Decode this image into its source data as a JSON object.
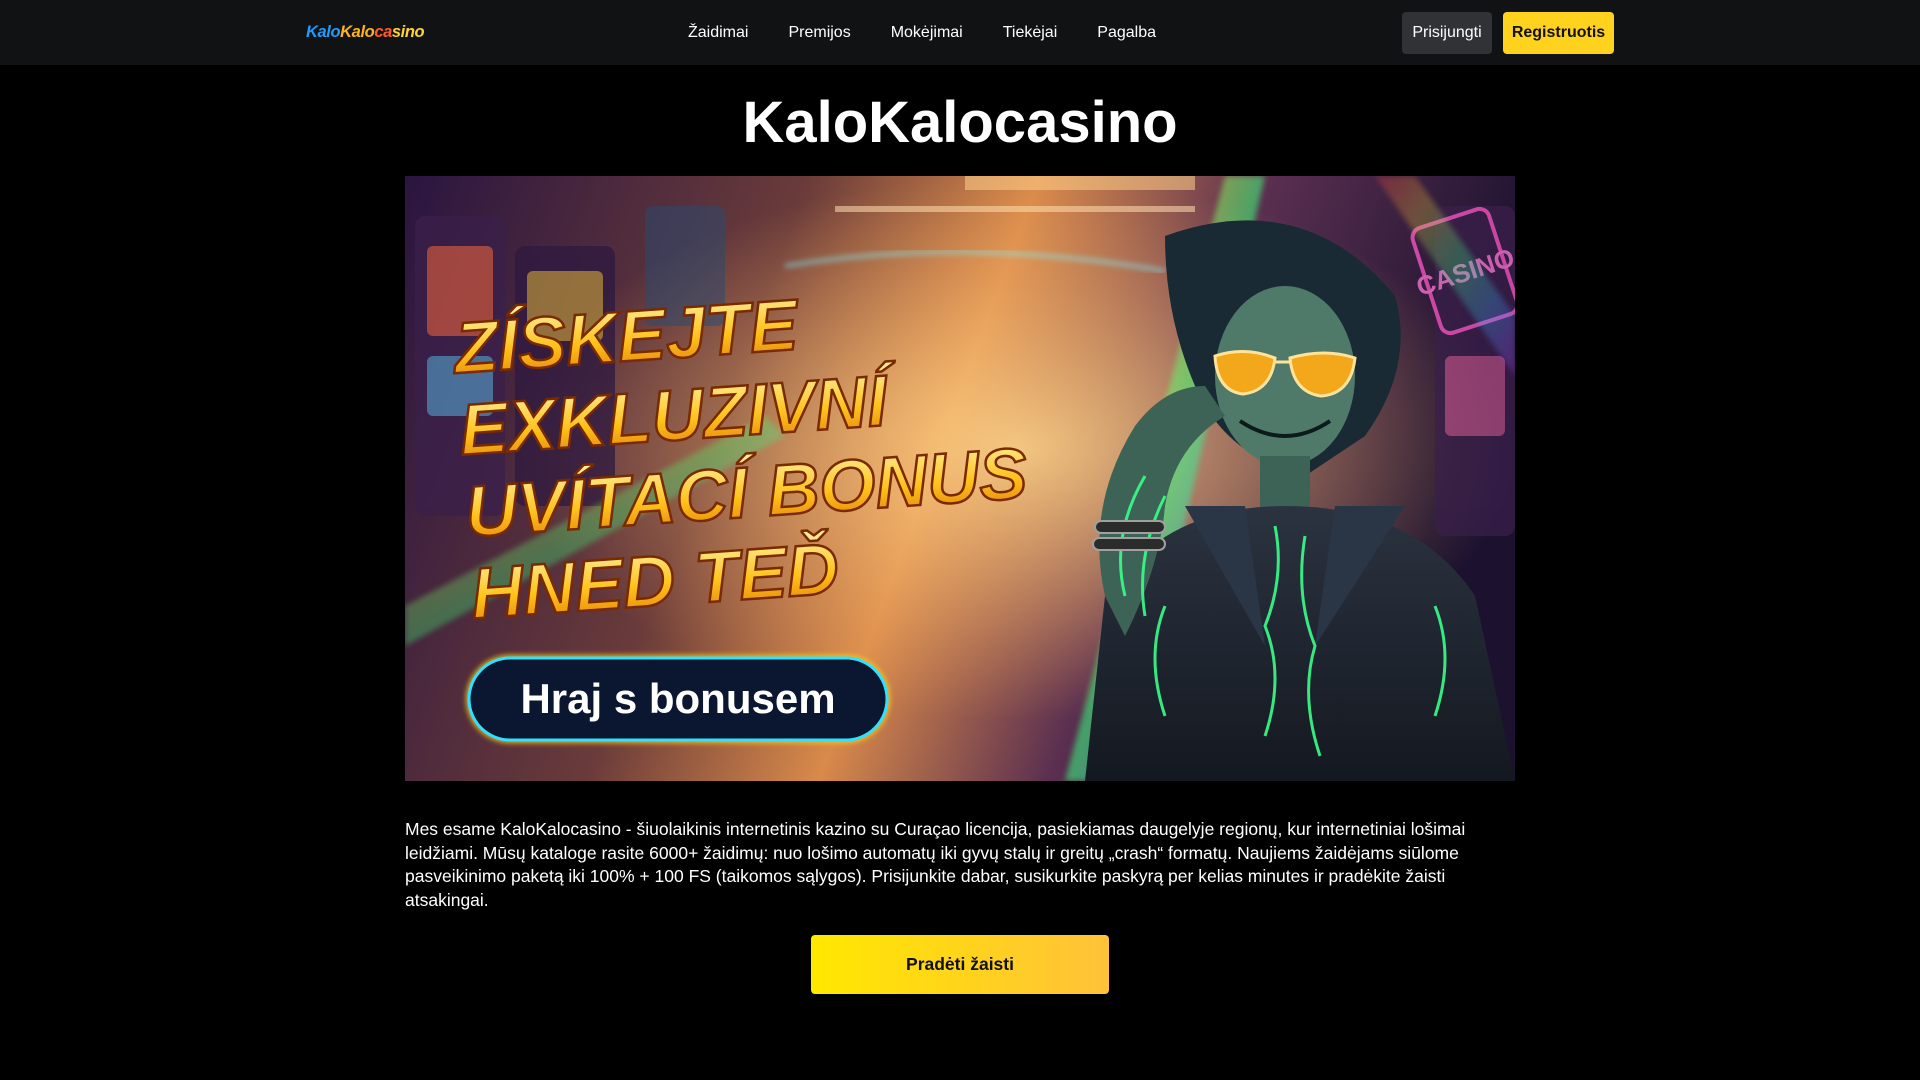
{
  "header": {
    "logo": {
      "part1": "Kalo",
      "part2": "Kalo",
      "part3": "ca",
      "part4": "sino"
    },
    "nav": [
      "Žaidimai",
      "Premijos",
      "Mokėjimai",
      "Tiekėjai",
      "Pagalba"
    ],
    "login_label": "Prisijungti",
    "register_label": "Registruotis"
  },
  "main": {
    "title": "KaloKalocasino",
    "banner": {
      "headline": [
        "ZÍSKEJTE",
        "EXKLUZIVNÍ",
        "UVÍTACÍ BONUS",
        "HNED TEĎ"
      ],
      "button_label": "Hraj s bonusem",
      "sign_text": "CASINO"
    },
    "intro": "Mes esame KaloKalocasino - šiuolaikinis internetinis kazino su Curaçao licencija, pasiekiamas daugelyje regionų, kur internetiniai lošimai leidžiami. Mūsų kataloge rasite 6000+ žaidimų: nuo lošimo automatų iki gyvų stalų ir greitų „crash“ formatų. Naujiems žaidėjams siūlome pasveikinimo paketą iki 100% + 100 FS (taikomos sąlygos). Prisijunkite dabar, susikurkite paskyrą per kelias minutes ir pradėkite žaisti atsakingai.",
    "cta_label": "Pradėti žaisti"
  },
  "colors": {
    "page_bg": "#000000",
    "header_bg": "#111214",
    "accent_yellow": "#ffd21e",
    "login_bg": "#303236"
  }
}
